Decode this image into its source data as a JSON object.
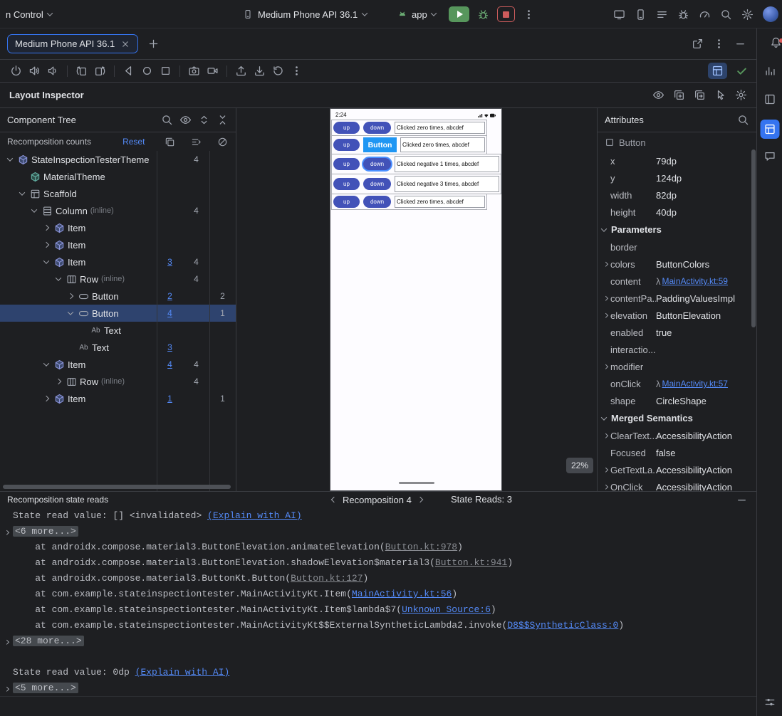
{
  "colors": {
    "bg": "#1e1f22",
    "border": "#393b40",
    "accent": "#3574f0",
    "link": "#548af7",
    "selection": "#2e436e",
    "run_green": "#57965c",
    "stop_red": "#cd5c5c",
    "device_button": "#4252b8",
    "overlay_blue": "#1f96f3"
  },
  "topbar": {
    "vcs_label": "n Control",
    "device_label": "Medium Phone API 36.1",
    "run_config_label": "app"
  },
  "tabbar": {
    "tab_label": "Medium Phone API 36.1"
  },
  "inspector": {
    "title": "Layout Inspector"
  },
  "tree": {
    "title": "Component Tree",
    "counts_header": "Recomposition counts",
    "reset_label": "Reset",
    "rows": [
      {
        "label": "StateInspectionTesterTheme",
        "depth": 0,
        "chevron": "down",
        "icon": "compose",
        "c2": "4"
      },
      {
        "label": "MaterialTheme",
        "depth": 1,
        "chevron": "none",
        "icon": "theme"
      },
      {
        "label": "Scaffold",
        "depth": 1,
        "chevron": "down",
        "icon": "scaffold"
      },
      {
        "label": "Column",
        "suffix": "(inline)",
        "depth": 2,
        "chevron": "down",
        "icon": "column",
        "c2": "4"
      },
      {
        "label": "Item",
        "depth": 3,
        "chevron": "right",
        "icon": "compose"
      },
      {
        "label": "Item",
        "depth": 3,
        "chevron": "right",
        "icon": "compose"
      },
      {
        "label": "Item",
        "depth": 3,
        "chevron": "down",
        "icon": "compose",
        "c1": "3",
        "c2": "4"
      },
      {
        "label": "Row",
        "suffix": "(inline)",
        "depth": 4,
        "chevron": "down",
        "icon": "row",
        "c2": "4"
      },
      {
        "label": "Button",
        "depth": 5,
        "chevron": "right",
        "icon": "button",
        "c1": "2",
        "c3": "2"
      },
      {
        "label": "Button",
        "depth": 5,
        "chevron": "down",
        "icon": "button",
        "c1": "4",
        "c3": "1",
        "selected": true
      },
      {
        "label": "Text",
        "depth": 6,
        "chevron": "none",
        "icon": "text"
      },
      {
        "label": "Text",
        "depth": 5,
        "chevron": "none",
        "icon": "text",
        "c1": "3"
      },
      {
        "label": "Item",
        "depth": 3,
        "chevron": "down",
        "icon": "compose",
        "c1": "4",
        "c2": "4"
      },
      {
        "label": "Row",
        "suffix": "(inline)",
        "depth": 4,
        "chevron": "right",
        "icon": "row",
        "c2": "4"
      },
      {
        "label": "Item",
        "depth": 3,
        "chevron": "right",
        "icon": "compose",
        "c1": "1",
        "c3": "1"
      }
    ]
  },
  "device": {
    "time": "2:24",
    "zoom_label": "22%",
    "status_icons": [
      "signal",
      "wifi",
      "battery"
    ],
    "rows": [
      {
        "up": "up",
        "second": "down",
        "text": "Clicked zero times, abcdef",
        "variant": "normal"
      },
      {
        "up": "up",
        "second": "Button",
        "text": "Clicked zero times, abcdef",
        "variant": "label"
      },
      {
        "up": "up",
        "second": "down",
        "text": "Clicked negative 1 times, abcdef",
        "variant": "selected"
      },
      {
        "up": "up",
        "second": "down",
        "text": "Clicked negative 3 times, abcdef",
        "variant": "tall"
      },
      {
        "up": "up",
        "second": "down",
        "text": "Clicked zero times, abcdef",
        "variant": "normal"
      }
    ]
  },
  "attributes": {
    "title": "Attributes",
    "component": "Button",
    "rows": [
      {
        "label": "x",
        "value": "79dp"
      },
      {
        "label": "y",
        "value": "124dp"
      },
      {
        "label": "width",
        "value": "82dp"
      },
      {
        "label": "height",
        "value": "40dp"
      },
      {
        "section": "Parameters"
      },
      {
        "label": "border",
        "value": ""
      },
      {
        "label": "colors",
        "value": "ButtonColors",
        "expand": true
      },
      {
        "label": "content",
        "lambda": "λ",
        "link": "MainActivity.kt:59"
      },
      {
        "label": "contentPa...",
        "value": "PaddingValuesImpl",
        "expand": true
      },
      {
        "label": "elevation",
        "value": "ButtonElevation",
        "expand": true
      },
      {
        "label": "enabled",
        "value": "true"
      },
      {
        "label": "interactio...",
        "value": ""
      },
      {
        "label": "modifier",
        "value": "",
        "expand": true
      },
      {
        "label": "onClick",
        "lambda": "λ",
        "link": "MainActivity.kt:57"
      },
      {
        "label": "shape",
        "value": "CircleShape"
      },
      {
        "section": "Merged Semantics"
      },
      {
        "label": "ClearText...",
        "value": "AccessibilityAction",
        "expand": true
      },
      {
        "label": "Focused",
        "value": "false"
      },
      {
        "label": "GetTextLa...",
        "value": "AccessibilityAction",
        "expand": true
      },
      {
        "label": "OnClick",
        "value": "AccessibilityAction",
        "expand": true
      }
    ]
  },
  "console": {
    "title": "Recomposition state reads",
    "nav_label": "Recomposition 4",
    "reads_label": "State Reads: 3",
    "lines": [
      {
        "type": "state",
        "text": "State read value: [] <invalidated> ",
        "link": "(Explain with AI)"
      },
      {
        "type": "chip",
        "text": "<6 more...>"
      },
      {
        "type": "frame",
        "prefix": "at androidx.compose.material3.ButtonElevation.animateElevation(",
        "ref": "Button.kt:978",
        "suffix": ")",
        "ref_style": "gray"
      },
      {
        "type": "frame",
        "prefix": "at androidx.compose.material3.ButtonElevation.shadowElevation$material3(",
        "ref": "Button.kt:941",
        "suffix": ")",
        "ref_style": "gray"
      },
      {
        "type": "frame",
        "prefix": "at androidx.compose.material3.ButtonKt.Button(",
        "ref": "Button.kt:127",
        "suffix": ")",
        "ref_style": "gray"
      },
      {
        "type": "frame",
        "prefix": "at com.example.stateinspectiontester.MainActivityKt.Item(",
        "ref": "MainActivity.kt:56",
        "suffix": ")",
        "ref_style": "blue"
      },
      {
        "type": "frame",
        "prefix": "at com.example.stateinspectiontester.MainActivityKt.Item$lambda$7(",
        "ref": "Unknown Source:6",
        "suffix": ")",
        "ref_style": "blue"
      },
      {
        "type": "frame",
        "prefix": "at com.example.stateinspectiontester.MainActivityKt$$ExternalSyntheticLambda2.invoke(",
        "ref": "D8$$SyntheticClass:0",
        "suffix": ")",
        "ref_style": "blue"
      },
      {
        "type": "chip",
        "text": "<28 more...>"
      },
      {
        "type": "blank"
      },
      {
        "type": "state",
        "text": "State read value: 0dp ",
        "link": "(Explain with AI)"
      },
      {
        "type": "chip",
        "text": "<5 more...>"
      }
    ]
  },
  "icons": {
    "topbar_right": [
      "device-mirror",
      "sync-device",
      "logcat",
      "debug-apk",
      "profiler",
      "search",
      "settings",
      "avatar"
    ],
    "right_stripe": [
      "notifications",
      "profiler",
      "device-explorer",
      "layout-inspector",
      "assistant",
      "tune"
    ]
  }
}
